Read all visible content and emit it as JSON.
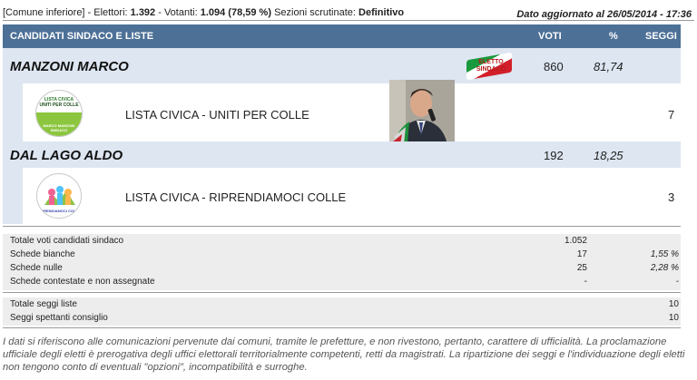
{
  "topbar": {
    "municipality": "[Comune inferiore]",
    "voters_label": "Elettori:",
    "voters_value": "1.392",
    "turnout_label": "Votanti:",
    "turnout_value": "1.094 (78,59 %)",
    "sections_label": "Sezioni scrutinate:",
    "sections_value": "Definitivo",
    "updated": "Dato aggiornato al 26/05/2014 - 17:36"
  },
  "header": {
    "title": "CANDIDATI SINDACO E LISTE",
    "col_votes": "VOTI",
    "col_pct": "%",
    "col_seats": "SEGGI"
  },
  "candidates": [
    {
      "name": "MANZONI MARCO",
      "votes": "860",
      "pct": "81,74",
      "badge_line1": "ELETTO",
      "badge_line2": "SINDACO",
      "list": {
        "name": "LISTA CIVICA - UNITI PER COLLE",
        "seats": "7",
        "logo_text_top": "LISTA CIVICA",
        "logo_text_mid": "UNITI PER COLLE",
        "logo_text_bottom": "MARCO MANZONI SINDACO"
      }
    },
    {
      "name": "DAL LAGO ALDO",
      "votes": "192",
      "pct": "18,25",
      "list": {
        "name": "LISTA CIVICA - RIPRENDIAMOCI COLLE",
        "seats": "3",
        "logo_text_bottom": "RIPRENDIAMOCI COLLE"
      }
    }
  ],
  "totals": [
    {
      "label": "Totale voti candidati sindaco",
      "value": "1.052",
      "pct": ""
    },
    {
      "label": "Schede bianche",
      "value": "17",
      "pct": "1,55 %"
    },
    {
      "label": "Schede nulle",
      "value": "25",
      "pct": "2,28 %"
    },
    {
      "label": "Schede contestate e non assegnate",
      "value": "-",
      "pct": "-"
    }
  ],
  "seats": [
    {
      "label": "Totale seggi liste",
      "value": "10"
    },
    {
      "label": "Seggi spettanti consiglio",
      "value": "10"
    }
  ],
  "note": "I dati si riferiscono alle comunicazioni pervenute dai comuni, tramite le prefetture, e non rivestono, pertanto, carattere di ufficialità. La proclamazione ufficiale degli eletti è prerogativa degli uffici elettorali territorialmente competenti, retti da magistrati. La ripartizione dei seggi e l'individuazione degli eletti non tengono conto di eventuali \"opzioni\", incompatibilità e surroghe."
}
